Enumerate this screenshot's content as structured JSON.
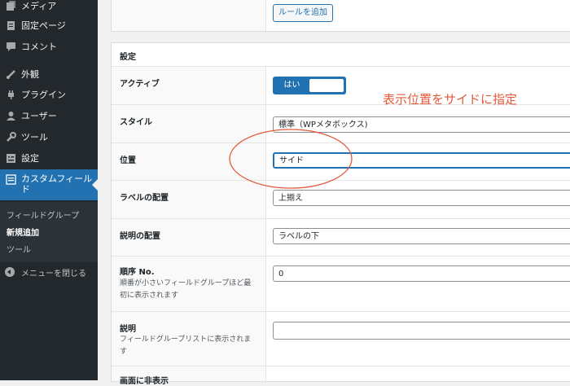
{
  "sidebar": {
    "items": [
      {
        "label": "メディア",
        "icon": "media-icon"
      },
      {
        "label": "固定ページ",
        "icon": "page-icon"
      },
      {
        "label": "コメント",
        "icon": "comment-icon"
      },
      {
        "label": "外観",
        "icon": "brush-icon"
      },
      {
        "label": "プラグイン",
        "icon": "plugin-icon"
      },
      {
        "label": "ユーザー",
        "icon": "user-icon"
      },
      {
        "label": "ツール",
        "icon": "wrench-icon"
      },
      {
        "label": "設定",
        "icon": "settings-icon"
      }
    ],
    "active": {
      "label": "カスタムフィールド",
      "icon": "custom-fields-icon"
    },
    "submenu": [
      "フィールドグループ",
      "新規追加",
      "ツール"
    ],
    "collapse_label": "メニューを閉じる"
  },
  "rules": {
    "add_rule_button": "ルールを追加"
  },
  "settings": {
    "title": "設定",
    "active_label": "アクティブ",
    "active_value": "はい",
    "style_label": "スタイル",
    "style_value": "標準（WPメタボックス)",
    "position_label": "位置",
    "position_value": "サイド",
    "label_placement_label": "ラベルの配置",
    "label_placement_value": "上揃え",
    "instruction_placement_label": "説明の配置",
    "instruction_placement_value": "ラベルの下",
    "order_label": "順序 No.",
    "order_desc": "順番が小さいフィールドグループほど最初に表示されます",
    "order_value": "0",
    "description_label": "説明",
    "description_desc": "フィールドグループリストに表示されます",
    "description_value": "",
    "hide_on_screen_label": "画面に非表示"
  },
  "annotation": {
    "text": "表示位置をサイドに指定",
    "color": "#e35a3b"
  },
  "colors": {
    "sidebar_bg": "#23282d",
    "accent": "#2271b1"
  }
}
